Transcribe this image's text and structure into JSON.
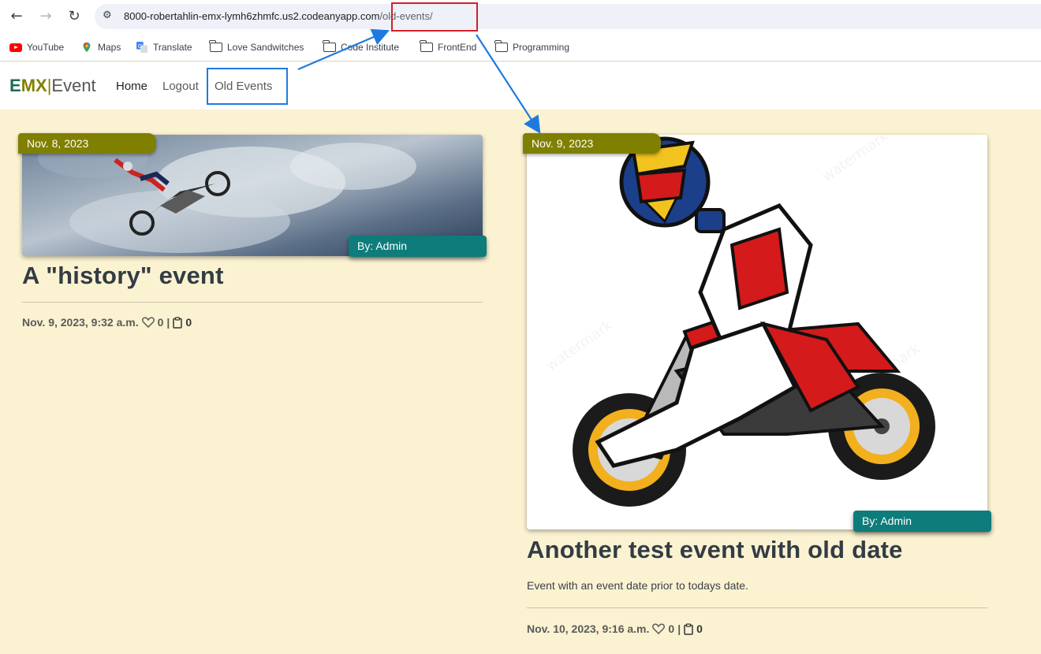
{
  "browser": {
    "url_host": "8000-robertahlin-emx-lymh6zhmfc.us2.codeanyapp.com",
    "url_path": "/old-events/",
    "bookmarks": [
      "YouTube",
      "Maps",
      "Translate",
      "Love Sandwitches",
      "Code Institute",
      "FrontEnd",
      "Programming"
    ]
  },
  "site": {
    "brand_e": "E",
    "brand_mx": "MX",
    "brand_sep": "|",
    "brand_rest": "Event",
    "nav": [
      "Home",
      "Logout",
      "Old Events"
    ]
  },
  "events": [
    {
      "date_badge": "Nov. 8, 2023",
      "author": "By: Admin",
      "title": "A \"history\" event",
      "excerpt": "",
      "meta_date": "Nov. 9, 2023, 9:32 a.m.",
      "likes": "0",
      "sep": "|",
      "comments": "0"
    },
    {
      "date_badge": "Nov. 9, 2023",
      "author": "By: Admin",
      "title": "Another test event with old date",
      "excerpt": "Event with an event date prior to todays date.",
      "meta_date": "Nov. 10, 2023, 9:16 a.m.",
      "likes": "0",
      "sep": "|",
      "comments": "0"
    }
  ],
  "colors": {
    "page_bg": "#fbf2d1",
    "date_badge": "#808000",
    "author_badge": "#0e7c7b",
    "annotation_red": "#d21f26",
    "annotation_blue": "#1f7ae0"
  }
}
